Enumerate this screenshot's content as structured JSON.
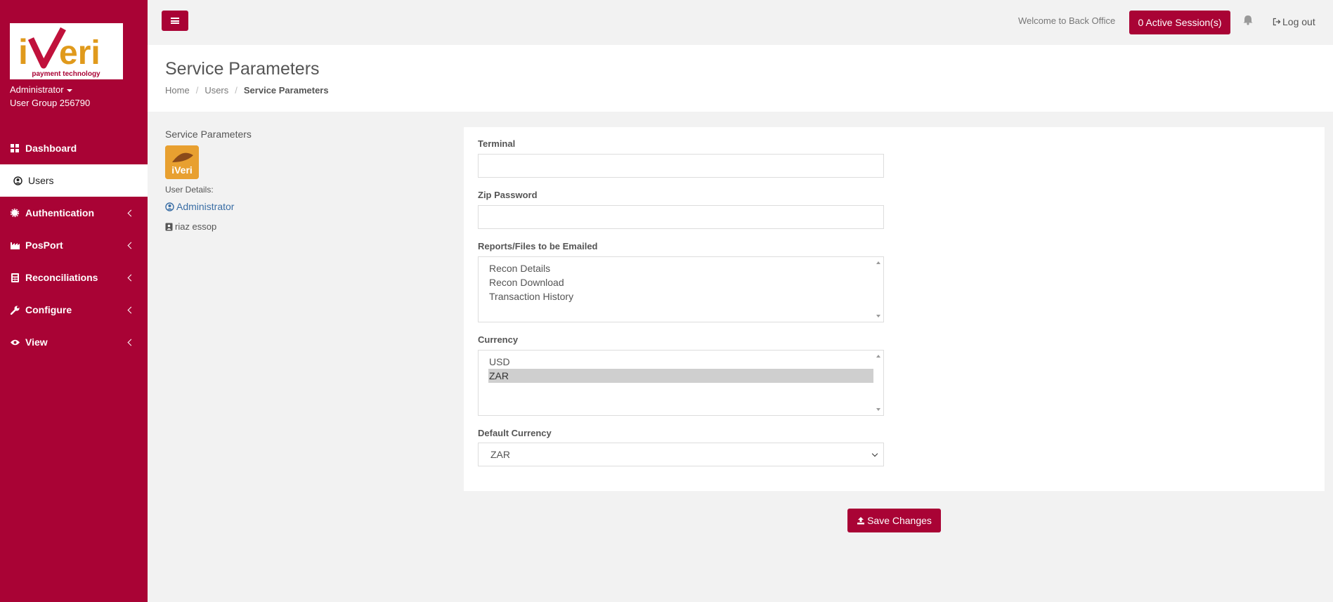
{
  "app": {
    "logo_text": "iVeri",
    "logo_tagline": "payment technology",
    "brand_color": "#a90335"
  },
  "sidebar": {
    "user_role": "Administrator",
    "user_group": "User Group 256790",
    "items": [
      {
        "label": "Dashboard",
        "icon": "dashboard-icon",
        "active": false,
        "has_submenu": false
      },
      {
        "label": "Users",
        "icon": "user-circle-icon",
        "active": true,
        "has_submenu": false
      },
      {
        "label": "Authentication",
        "icon": "cog-icon",
        "active": false,
        "has_submenu": true
      },
      {
        "label": "PosPort",
        "icon": "factory-icon",
        "active": false,
        "has_submenu": true
      },
      {
        "label": "Reconciliations",
        "icon": "calculator-icon",
        "active": false,
        "has_submenu": true
      },
      {
        "label": "Configure",
        "icon": "wrench-icon",
        "active": false,
        "has_submenu": true
      },
      {
        "label": "View",
        "icon": "eye-icon",
        "active": false,
        "has_submenu": true
      }
    ]
  },
  "topbar": {
    "welcome": "Welcome to Back Office",
    "sessions": "0 Active Session(s)",
    "logout": "Log out"
  },
  "header": {
    "title": "Service Parameters",
    "breadcrumb": [
      "Home",
      "Users",
      "Service Parameters"
    ]
  },
  "user_panel": {
    "title": "Service Parameters",
    "details_label": "User Details:",
    "username": "Administrator",
    "full_name": "riaz essop"
  },
  "form": {
    "terminal": {
      "label": "Terminal",
      "value": ""
    },
    "zip_password": {
      "label": "Zip Password",
      "value": ""
    },
    "reports": {
      "label": "Reports/Files to be Emailed",
      "options": [
        "Recon Details",
        "Recon Download",
        "Transaction History"
      ]
    },
    "currency": {
      "label": "Currency",
      "options": [
        "USD",
        "ZAR"
      ],
      "selected": "ZAR"
    },
    "default_currency": {
      "label": "Default Currency",
      "value": "ZAR"
    },
    "save_label": "Save Changes"
  }
}
